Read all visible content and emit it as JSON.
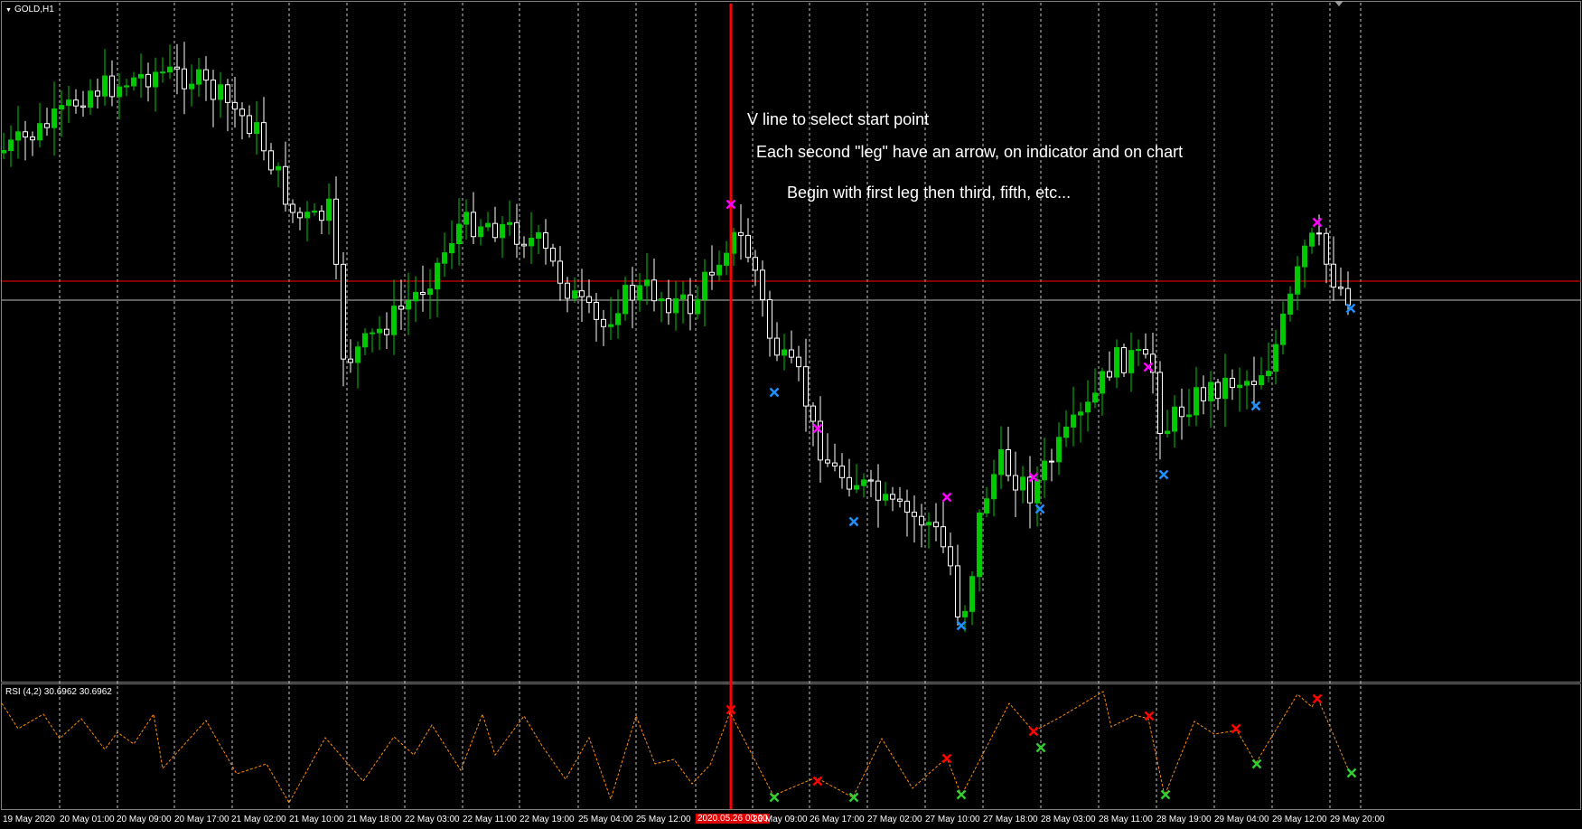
{
  "window": {
    "symbol_title": "GOLD,H1",
    "rsi_title": "RSI (4,2) 30.6962 30.6962"
  },
  "annotations": [
    "V line to select start point",
    "Each second \"leg\" have an arrow, on indicator and on chart",
    "Begin with first leg then third, fifth, etc..."
  ],
  "time_axis": {
    "labels": [
      "19 May 2020",
      "20 May 01:00",
      "20 May 09:00",
      "20 May 17:00",
      "21 May 02:00",
      "21 May 10:00",
      "21 May 18:00",
      "22 May 03:00",
      "22 May 11:00",
      "22 May 19:00",
      "25 May 04:00",
      "25 May 12:00",
      "26 May 09:00",
      "26 May 17:00",
      "27 May 02:00",
      "27 May 10:00",
      "27 May 18:00",
      "28 May 03:00",
      "28 May 11:00",
      "28 May 19:00",
      "29 May 04:00",
      "29 May 12:00",
      "29 May 20:00"
    ],
    "vline_label": "2020.05.26 00:00"
  },
  "colors": {
    "background": "#000000",
    "bull_candle": "#00c800",
    "bear_candle": "#ffffff",
    "grid": "#c8c8c8",
    "vline": "#ff0000",
    "hline_red": "#ff0000",
    "hline_gray": "#c0c0c0",
    "rsi_line": "#ff8c00",
    "chart_top_marker": "#ff00ff",
    "chart_bottom_marker": "#1e90ff",
    "rsi_top_marker": "#ff0000",
    "rsi_bottom_marker": "#32cd32"
  },
  "icons": {
    "top_marker": "x-cross-icon",
    "bottom_marker": "x-cross-icon",
    "title_arrow": "triangle-down-icon"
  }
}
